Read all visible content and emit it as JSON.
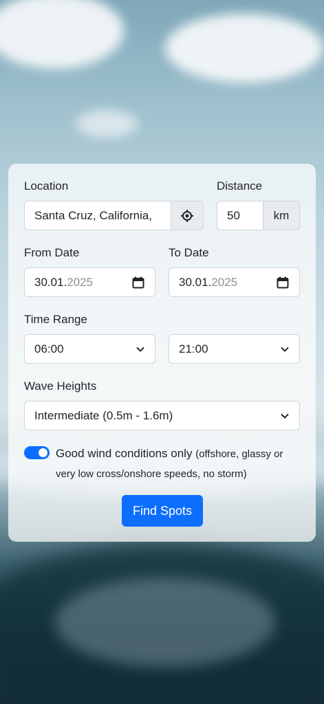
{
  "form": {
    "location": {
      "label": "Location",
      "value": "Santa Cruz, California,",
      "locate_icon": "crosshair-icon"
    },
    "distance": {
      "label": "Distance",
      "value": "50",
      "unit": "km"
    },
    "from_date": {
      "label": "From Date",
      "day_month": "30.01.",
      "year": "2025",
      "icon": "calendar-icon"
    },
    "to_date": {
      "label": "To Date",
      "day_month": "30.01.",
      "year": "2025",
      "icon": "calendar-icon"
    },
    "time_range": {
      "label": "Time Range",
      "start": "06:00",
      "end": "21:00"
    },
    "wave_heights": {
      "label": "Wave Heights",
      "selected": "Intermediate (0.5m - 1.6m)"
    },
    "wind_toggle": {
      "on": true,
      "label": "Good wind conditions only",
      "detail": "(offshore, glassy or very low cross/onshore speeds, no storm)"
    },
    "submit_label": "Find Spots"
  },
  "colors": {
    "accent": "#0d6efd",
    "card_bg": "rgba(255,255,255,0.72)",
    "addon_bg": "#e9ecef",
    "border": "#ced4da"
  }
}
